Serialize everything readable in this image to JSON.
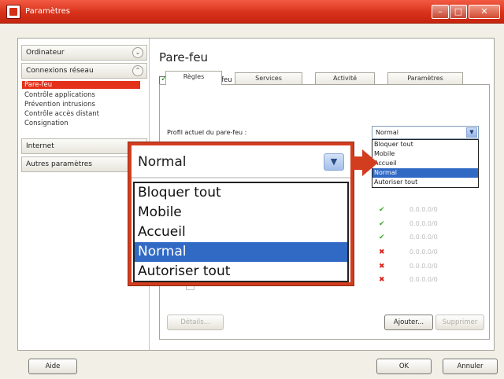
{
  "window": {
    "title": "Paramètres"
  },
  "sidebar": {
    "sections": [
      {
        "label": "Ordinateur",
        "chevron": "⌄"
      },
      {
        "label": "Connexions réseau",
        "chevron": "⌃"
      },
      {
        "label": "Internet"
      },
      {
        "label": "Autres paramètres"
      }
    ],
    "items": [
      "Pare-feu",
      "Contrôle applications",
      "Prévention intrusions",
      "Contrôle accès distant",
      "Consignation"
    ]
  },
  "main": {
    "title": "Pare-feu",
    "enable_label": "Activer le pare-feu",
    "tabs": [
      "Règles",
      "Services",
      "Activité",
      "Paramètres"
    ],
    "profile_label": "Profil actuel du pare-feu :",
    "profile_value": "Normal",
    "profile_options": [
      "Bloquer tout",
      "Mobile",
      "Accueil",
      "Normal",
      "Autoriser tout"
    ],
    "rule_ips": [
      "0.0.0.0/0",
      "0.0.0.0/0",
      "0.0.0.0/0",
      "0.0.0.0/0",
      "0.0.0.0/0",
      "0.0.0.0/0"
    ],
    "buttons": {
      "details": "Détails...",
      "add": "Ajouter...",
      "delete": "Supprimer"
    }
  },
  "footer": {
    "help": "Aide",
    "ok": "OK",
    "cancel": "Annuler"
  },
  "colors": {
    "accent": "#d33d1f",
    "selection": "#316ac5"
  }
}
